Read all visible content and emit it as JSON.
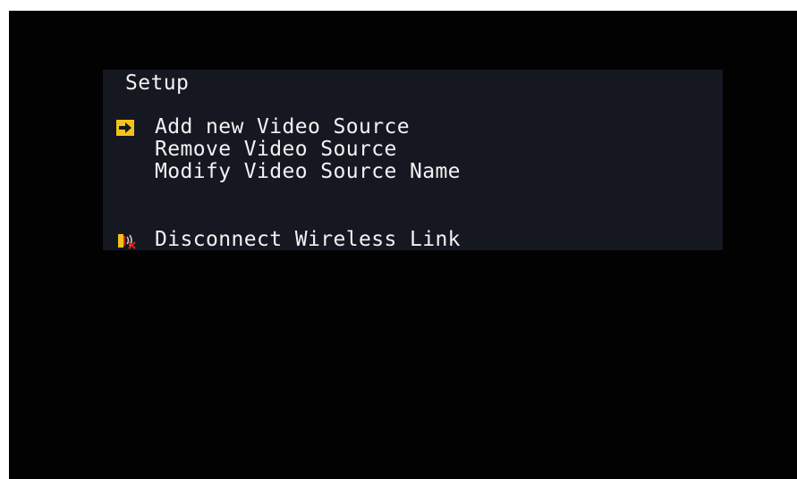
{
  "menu": {
    "title": "Setup",
    "items": [
      {
        "label": "Add new Video Source",
        "selected": true
      },
      {
        "label": "Remove Video Source",
        "selected": false
      },
      {
        "label": "Modify Video Source Name",
        "selected": false
      }
    ],
    "disconnect": {
      "label": "Disconnect Wireless Link",
      "icon": "disconnect-wireless-icon"
    }
  },
  "colors": {
    "background": "#020202",
    "panel": "#151821",
    "text": "#f2f2f2",
    "accent": "#f2c21c"
  },
  "icons": {
    "selection": "arrow-right-icon"
  }
}
